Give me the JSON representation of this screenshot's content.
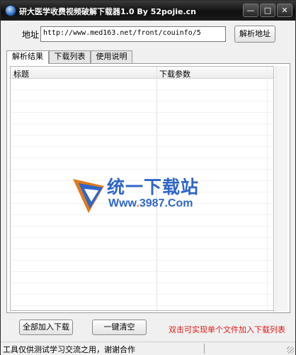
{
  "window": {
    "title": "研大医学收费视频破解下载器1.0 By 52pojie.cn",
    "controls": {
      "minimize": "—",
      "maximize": "□",
      "close": "✕"
    }
  },
  "address": {
    "label": "地址",
    "value": "http://www.med163.net/front/couinfo/5",
    "parse_button": "解析地址"
  },
  "tabs": [
    {
      "label": "解析结果",
      "active": true
    },
    {
      "label": "下载列表",
      "active": false
    },
    {
      "label": "使用说明",
      "active": false
    }
  ],
  "list": {
    "columns": [
      "标题",
      "下载参数"
    ],
    "rows": []
  },
  "watermark": {
    "text": "统一下载站",
    "url_prefix": "Www",
    "url_dot": ".",
    "url_rest": "3987.Com"
  },
  "buttons": {
    "add_all": "全部加入下载",
    "clear": "一键清空"
  },
  "hint": "双击可实现单个文件加入下载列表",
  "status": "工具仅供测试学习交流之用，谢谢合作",
  "colors": {
    "title_bar": "#1a1a1a",
    "hint_red": "#e01a1a",
    "watermark_blue": "#2f66c9",
    "watermark_orange": "#e07a1a"
  }
}
